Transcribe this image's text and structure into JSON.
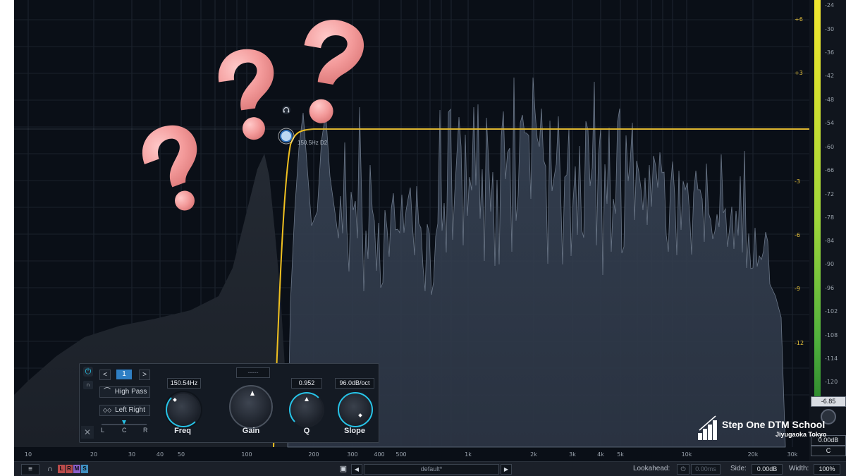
{
  "graph": {
    "node_label": "150.5Hz D2",
    "freq_labels": [
      "10",
      "20",
      "30",
      "40",
      "50",
      "100",
      "200",
      "300",
      "400",
      "500",
      "1k",
      "2k",
      "3k",
      "4k",
      "5k",
      "10k",
      "20k",
      "30k"
    ],
    "gain_labels": [
      "+6",
      "+3",
      "-3",
      "-6",
      "-9",
      "-12"
    ],
    "db_labels": [
      "-24",
      "-30",
      "-36",
      "-42",
      "-48",
      "-54",
      "-60",
      "-66",
      "-72",
      "-78",
      "-84",
      "-90",
      "-96",
      "-102",
      "-108",
      "-114",
      "-120"
    ]
  },
  "meter": {
    "peak_value": "-6.85",
    "output_gain": "0.00dB",
    "pan": "C"
  },
  "band_panel": {
    "band_number": "1",
    "filter_type": "High Pass",
    "channel_mode": "Left Right",
    "pan_l": "L",
    "pan_c": "C",
    "pan_r": "R",
    "freq_value": "150.54Hz",
    "gain_value": "-----",
    "q_value": "0.952",
    "slope_value": "96.0dB/oct",
    "freq_label": "Freq",
    "gain_label": "Gain",
    "q_label": "Q",
    "slope_label": "Slope"
  },
  "bottom_bar": {
    "lrms": [
      "L",
      "R",
      "M",
      "S"
    ],
    "preset_name": "default*",
    "lookahead_label": "Lookahead:",
    "lookahead_value": "0.00ms",
    "side_label": "Side:",
    "side_value": "0.00dB",
    "width_label": "Width:",
    "width_value": "100%"
  },
  "watermark": {
    "title": "Step One DTM School",
    "subtitle": "Jiyugaoka Tokyo"
  },
  "colors": {
    "accent_curve": "#f0c020",
    "accent_cyan": "#27c4e8",
    "background": "#0a0f17"
  }
}
